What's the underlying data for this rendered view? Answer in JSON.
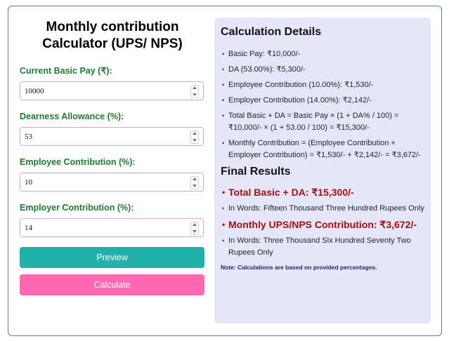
{
  "form": {
    "title_line1": "Monthly contribution",
    "title_line2": "Calculator (UPS/ NPS)",
    "basic_pay_label": "Current Basic Pay (₹):",
    "basic_pay_value": "10000",
    "da_label": "Dearness Allowance (%):",
    "da_value": "53",
    "employee_label": "Employee Contribution (%):",
    "employee_value": "10",
    "employer_label": "Employer Contribution (%):",
    "employer_value": "14",
    "preview_label": "Preview",
    "calculate_label": "Calculate"
  },
  "details": {
    "title": "Calculation Details",
    "items": [
      "Basic Pay: ₹10,000/-",
      "DA (53.00%): ₹5,300/-",
      "Employee Contribution (10.00%): ₹1,530/-",
      "Employer Contribution (14.00%): ₹2,142/-",
      "Total Basic + DA = Basic Pay × (1 + DA% / 100) = ₹10,000/- × (1 + 53.00 / 100) = ₹15,300/-",
      "Monthly Contribution = (Employee Contribution + Employer Contribution) = ₹1,530/- + ₹2,142/- = ₹3,672/-"
    ]
  },
  "results": {
    "title": "Final Results",
    "total_label": "Total Basic + DA: ₹15,300/-",
    "total_words": "In Words: Fifteen Thousand Three Hundred Rupees Only",
    "contribution_label": "Monthly UPS/NPS Contribution: ₹3,672/-",
    "contribution_words": "In Words: Three Thousand Six Hundred Seventy Two Rupees Only",
    "note": "Note: Calculations are based on provided percentages."
  },
  "colors": {
    "label_green": "#1f7a32",
    "preview_teal": "#20b2aa",
    "calculate_pink": "#ff69b4",
    "panel_lavender": "#e6e6fa",
    "result_red": "#a50e0e"
  }
}
